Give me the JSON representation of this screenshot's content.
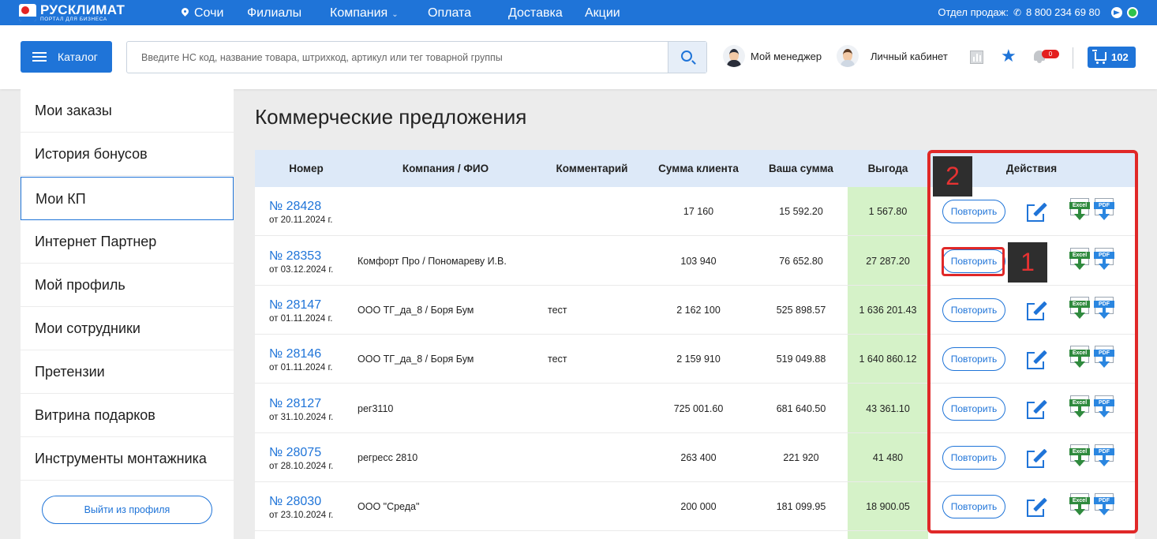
{
  "topbar": {
    "logo_name": "РУСКЛИМАТ",
    "logo_sub": "ПОРТАЛ ДЛЯ БИЗНЕСА",
    "city": "Сочи",
    "nav": [
      "Филиалы",
      "Компания",
      "Оплата",
      "Доставка",
      "Акции"
    ],
    "sales_label": "Отдел продаж:",
    "phone": "8 800 234 69 80"
  },
  "header": {
    "catalog_label": "Каталог",
    "search_placeholder": "Введите НС код, название товара, штрихкод, артикул или тег товарной группы",
    "manager_label": "Мой менеджер",
    "cabinet_label": "Личный кабинет",
    "notifications_count": "0",
    "cart_count": "102"
  },
  "sidebar": {
    "items": [
      "Мои заказы",
      "История бонусов",
      "Мои КП",
      "Интернет Партнер",
      "Мой профиль",
      "Мои сотрудники",
      "Претензии",
      "Витрина подарков",
      "Инструменты монтажника"
    ],
    "active_index": 2,
    "logout_label": "Выйти из профиля"
  },
  "main": {
    "title": "Коммерческие предложения",
    "columns": [
      "Номер",
      "Компания / ФИО",
      "Комментарий",
      "Сумма клиента",
      "Ваша сумма",
      "Выгода",
      "Действия"
    ],
    "repeat_label": "Повторить",
    "excel_label": "Excel",
    "pdf_label": "PDF",
    "rows": [
      {
        "number": "№ 28428",
        "date": "от 20.11.2024 г.",
        "company": "",
        "comment": "",
        "client_sum": "17 160",
        "your_sum": "15 592.20",
        "benefit": "1 567.80"
      },
      {
        "number": "№ 28353",
        "date": "от 03.12.2024 г.",
        "company": "Комфорт Про / Пономареву И.В.",
        "comment": "",
        "client_sum": "103 940",
        "your_sum": "76 652.80",
        "benefit": "27 287.20"
      },
      {
        "number": "№ 28147",
        "date": "от 01.11.2024 г.",
        "company": "ООО ТГ_да_8 / Боря Бум",
        "comment": "тест",
        "client_sum": "2 162 100",
        "your_sum": "525 898.57",
        "benefit": "1 636 201.43"
      },
      {
        "number": "№ 28146",
        "date": "от 01.11.2024 г.",
        "company": "ООО ТГ_да_8 / Боря Бум",
        "comment": "тест",
        "client_sum": "2 159 910",
        "your_sum": "519 049.88",
        "benefit": "1 640 860.12"
      },
      {
        "number": "№ 28127",
        "date": "от 31.10.2024 г.",
        "company": "рег3110",
        "comment": "",
        "client_sum": "725 001.60",
        "your_sum": "681 640.50",
        "benefit": "43 361.10"
      },
      {
        "number": "№ 28075",
        "date": "от 28.10.2024 г.",
        "company": "регресс 2810",
        "comment": "",
        "client_sum": "263 400",
        "your_sum": "221 920",
        "benefit": "41 480"
      },
      {
        "number": "№ 28030",
        "date": "от 23.10.2024 г.",
        "company": "ООО \"Среда\"",
        "comment": "",
        "client_sum": "200 000",
        "your_sum": "181 099.95",
        "benefit": "18 900.05"
      }
    ]
  },
  "annotations": {
    "badge_1": "1",
    "badge_2": "2",
    "accent_color": "#e02828"
  },
  "colors": {
    "brand": "#1f74d8",
    "benefit_bg": "#d5f2c8",
    "header_bg": "#dde9f8"
  }
}
